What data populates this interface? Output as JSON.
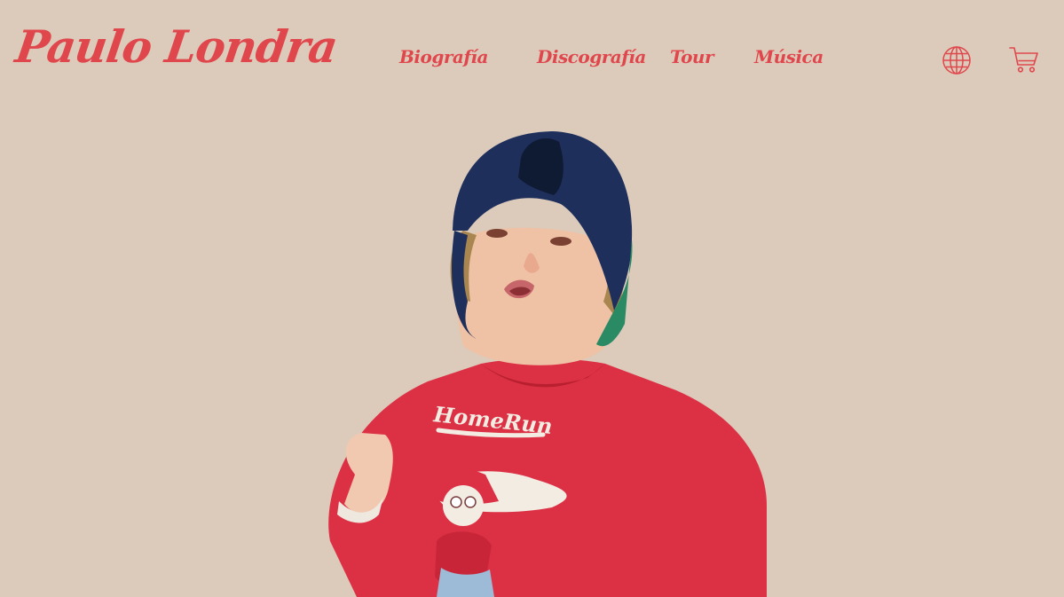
{
  "header": {
    "logo_text": "Paulo Londra",
    "nav": [
      {
        "label": "Biografía"
      },
      {
        "label": "Discografía"
      },
      {
        "label": "Tour"
      },
      {
        "label": "Música"
      }
    ],
    "icons": {
      "language": "globe-icon",
      "cart": "cart-icon"
    }
  },
  "hero": {
    "image_subject": "child-portrait-photo",
    "sweater_text": "HomeRun"
  },
  "colors": {
    "background": "#dccbbb",
    "accent": "#e0474c",
    "sweater": "#e0364b",
    "cap": "#1e2f5c"
  }
}
